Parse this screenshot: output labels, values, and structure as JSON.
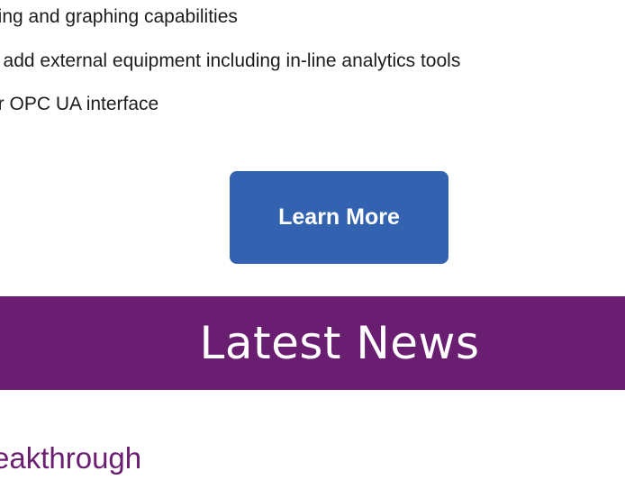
{
  "features": {
    "items": [
      "ging and graphing capabilities",
      "o add external equipment including in-line analytics tools",
      "or OPC UA interface"
    ]
  },
  "cta": {
    "label": "Learn More",
    "color": "#3363b0"
  },
  "news": {
    "heading": "Latest News",
    "banner_color": "#6a1e72",
    "article_title": "eakthrough"
  }
}
